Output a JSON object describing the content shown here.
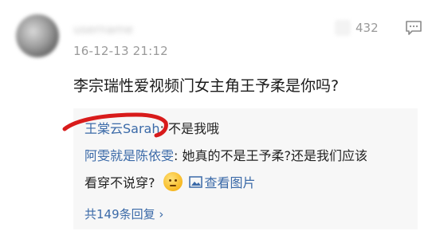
{
  "comment": {
    "like_count": "432",
    "timestamp": "16-12-13 21:12",
    "text": "李宗瑞性爱视频门女主角王予柔是你吗?"
  },
  "replies": [
    {
      "author": "王棠云Sarah",
      "separator": ":",
      "text": "不是我哦"
    },
    {
      "author": "阿雯就是陈依雯",
      "separator": ":",
      "text_line1": "她真的不是王予柔?还是我们应该",
      "text_line2": "看穿不说穿?"
    }
  ],
  "view_image_label": "查看图片",
  "more_replies_label": "共149条回复 ›",
  "colors": {
    "link": "#3b6aa8",
    "annotation": "#d81b1b",
    "reply_bg": "#f7f7f7"
  },
  "icons": [
    "thumbs-up-icon",
    "reply-icon",
    "thinking-emoji-icon",
    "image-icon"
  ]
}
